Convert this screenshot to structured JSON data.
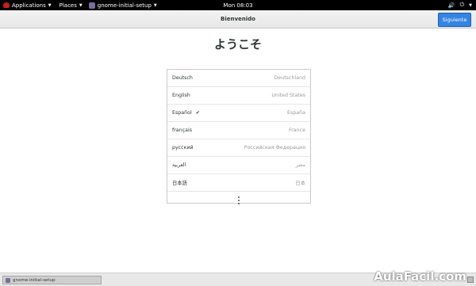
{
  "topbar": {
    "applications": "Applications",
    "places": "Places",
    "app_name": "gnome-initial-setup",
    "clock": "Mon 08:03"
  },
  "header": {
    "title": "Bienvenido",
    "next_button": "Siguiente"
  },
  "main": {
    "welcome_text": "ようこそ",
    "languages": [
      {
        "name": "Deutsch",
        "region": "Deutschland",
        "selected": false
      },
      {
        "name": "English",
        "region": "United States",
        "selected": false
      },
      {
        "name": "Español",
        "region": "España",
        "selected": true
      },
      {
        "name": "français",
        "region": "France",
        "selected": false
      },
      {
        "name": "русский",
        "region": "Российская Федерация",
        "selected": false
      },
      {
        "name": "العربية",
        "region": "مصر",
        "selected": false
      },
      {
        "name": "日本語",
        "region": "日本",
        "selected": false
      }
    ],
    "more_icon": "vertical-ellipsis-icon"
  },
  "bottombar": {
    "task_label": "gnome-initial-setup",
    "brand": "AulaFacil.com"
  },
  "icons": {
    "selected_check": "✔",
    "volume": "🔊",
    "power": "⏻"
  },
  "colors": {
    "accent": "#3584e4",
    "topbar": "#000000"
  }
}
